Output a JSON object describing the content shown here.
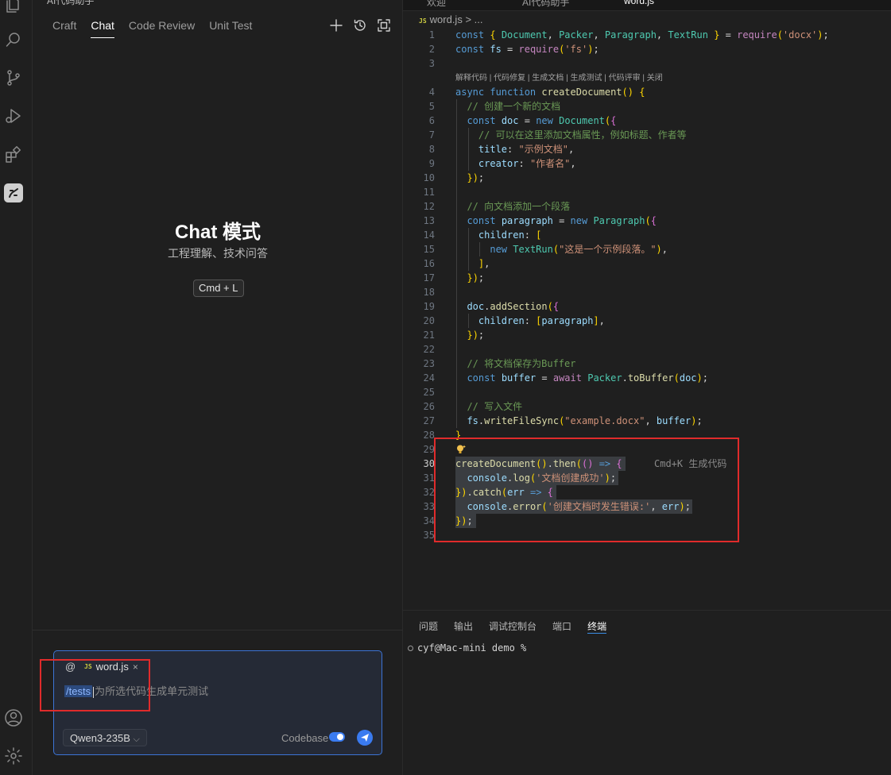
{
  "chat": {
    "top_title": "AI代码助手",
    "tabs": [
      {
        "label": "Craft",
        "active": false
      },
      {
        "label": "Chat",
        "active": true
      },
      {
        "label": "Code Review",
        "active": false
      },
      {
        "label": "Unit Test",
        "active": false
      }
    ],
    "hero_title": "Chat 模式",
    "hero_subtitle": "工程理解、技术问答",
    "shortcut": "Cmd + L",
    "input": {
      "mention": "@",
      "file_chip": "word.js",
      "command": "/tests",
      "hint": "为所选代码生成单元测试",
      "model": "Qwen3-235B",
      "codebase_label": "Codebase",
      "codebase_enabled": true
    }
  },
  "editor": {
    "tab_strip": [
      "欢迎",
      "AI代码助手",
      "word.js"
    ],
    "breadcrumb": {
      "file": "word.js",
      "rest": " > ..."
    },
    "codelens": "解释代码 | 代码修复 | 生成文档 | 生成测试 | 代码评审 | 关闭",
    "ghost_hint": "Cmd+K 生成代码",
    "current_line": 30,
    "lines": [
      {
        "n": 1,
        "t": "const { Document, Packer, Paragraph, TextRun } = require('docx');"
      },
      {
        "n": 2,
        "t": "const fs = require('fs');"
      },
      {
        "n": 3,
        "t": ""
      },
      {
        "n": 4,
        "t": "async function createDocument() {"
      },
      {
        "n": 5,
        "t": "  // 创建一个新的文档"
      },
      {
        "n": 6,
        "t": "  const doc = new Document({"
      },
      {
        "n": 7,
        "t": "    // 可以在这里添加文档属性，例如标题、作者等"
      },
      {
        "n": 8,
        "t": "    title: \"示例文档\","
      },
      {
        "n": 9,
        "t": "    creator: \"作者名\","
      },
      {
        "n": 10,
        "t": "  });"
      },
      {
        "n": 11,
        "t": ""
      },
      {
        "n": 12,
        "t": "  // 向文档添加一个段落"
      },
      {
        "n": 13,
        "t": "  const paragraph = new Paragraph({"
      },
      {
        "n": 14,
        "t": "    children: ["
      },
      {
        "n": 15,
        "t": "      new TextRun(\"这是一个示例段落。\"),"
      },
      {
        "n": 16,
        "t": "    ],"
      },
      {
        "n": 17,
        "t": "  });"
      },
      {
        "n": 18,
        "t": ""
      },
      {
        "n": 19,
        "t": "  doc.addSection({"
      },
      {
        "n": 20,
        "t": "    children: [paragraph],"
      },
      {
        "n": 21,
        "t": "  });"
      },
      {
        "n": 22,
        "t": ""
      },
      {
        "n": 23,
        "t": "  // 将文档保存为Buffer"
      },
      {
        "n": 24,
        "t": "  const buffer = await Packer.toBuffer(doc);"
      },
      {
        "n": 25,
        "t": ""
      },
      {
        "n": 26,
        "t": "  // 写入文件"
      },
      {
        "n": 27,
        "t": "  fs.writeFileSync(\"example.docx\", buffer);"
      },
      {
        "n": 28,
        "t": "}"
      },
      {
        "n": 29,
        "t": ""
      },
      {
        "n": 30,
        "t": "createDocument().then(() => {"
      },
      {
        "n": 31,
        "t": "  console.log('文档创建成功');"
      },
      {
        "n": 32,
        "t": "}).catch(err => {"
      },
      {
        "n": 33,
        "t": "  console.error('创建文档时发生错误:', err);"
      },
      {
        "n": 34,
        "t": "});"
      },
      {
        "n": 35,
        "t": ""
      }
    ]
  },
  "panel": {
    "tabs": [
      {
        "label": "问题",
        "active": false
      },
      {
        "label": "输出",
        "active": false
      },
      {
        "label": "调试控制台",
        "active": false
      },
      {
        "label": "端口",
        "active": false
      },
      {
        "label": "终端",
        "active": true
      }
    ],
    "prompt": "cyf@Mac-mini demo %"
  },
  "colors": {
    "accent": "#3a7bf0",
    "highlight_box": "#e02b2b",
    "background": "#1f1f1f"
  }
}
